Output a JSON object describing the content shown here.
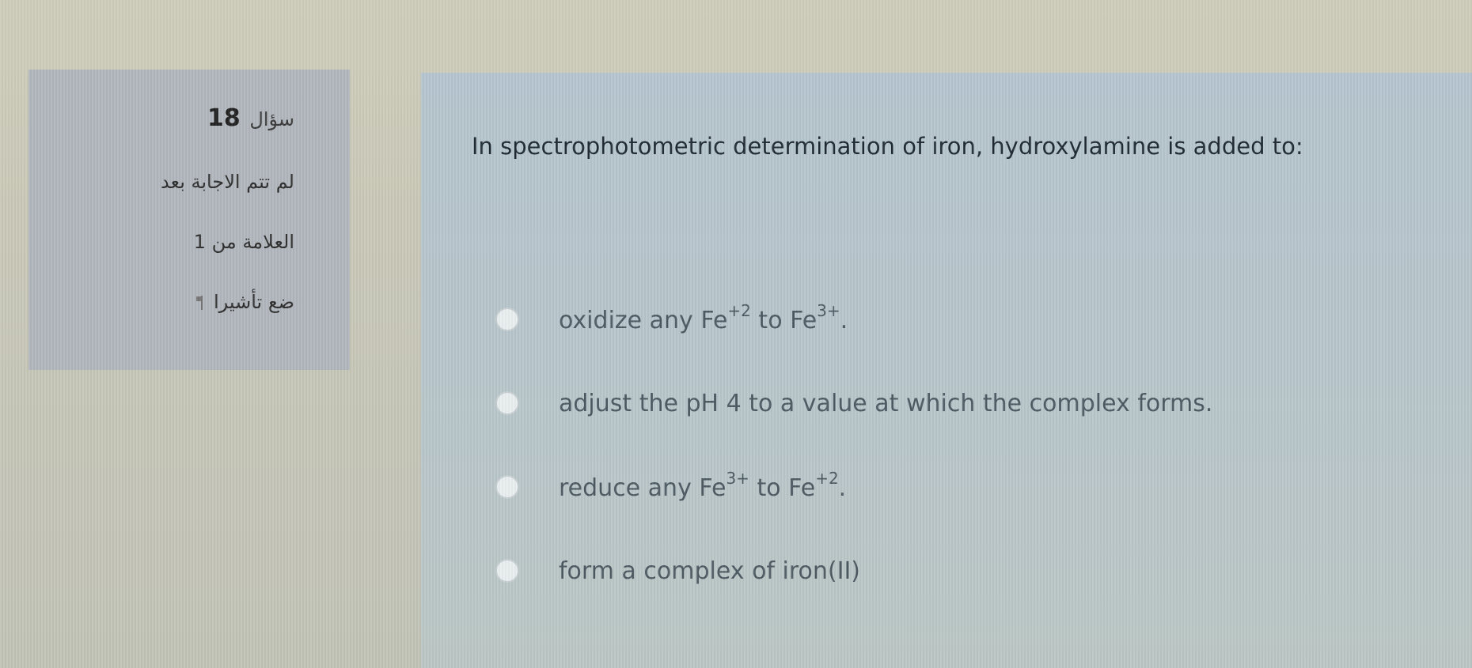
{
  "sidebar": {
    "question_label": "سؤال",
    "question_number": "18",
    "status": "لم تتم الاجابة بعد",
    "mark": "العلامة من 1",
    "flag_label": "ضع تأشيرا"
  },
  "question": {
    "text": "In spectrophotometric determination of iron, hydroxylamine is added to:",
    "options": [
      {
        "pre": "oxidize any Fe",
        "sup1": "+2",
        "mid": " to Fe",
        "sup2": "3+",
        "post": "."
      },
      {
        "text": "adjust the pH 4 to a value at which the complex forms."
      },
      {
        "pre": "reduce any Fe",
        "sup1": "3+",
        "mid": " to Fe",
        "sup2": "+2",
        "post": "."
      },
      {
        "text": "form a complex of iron(II)"
      }
    ]
  }
}
